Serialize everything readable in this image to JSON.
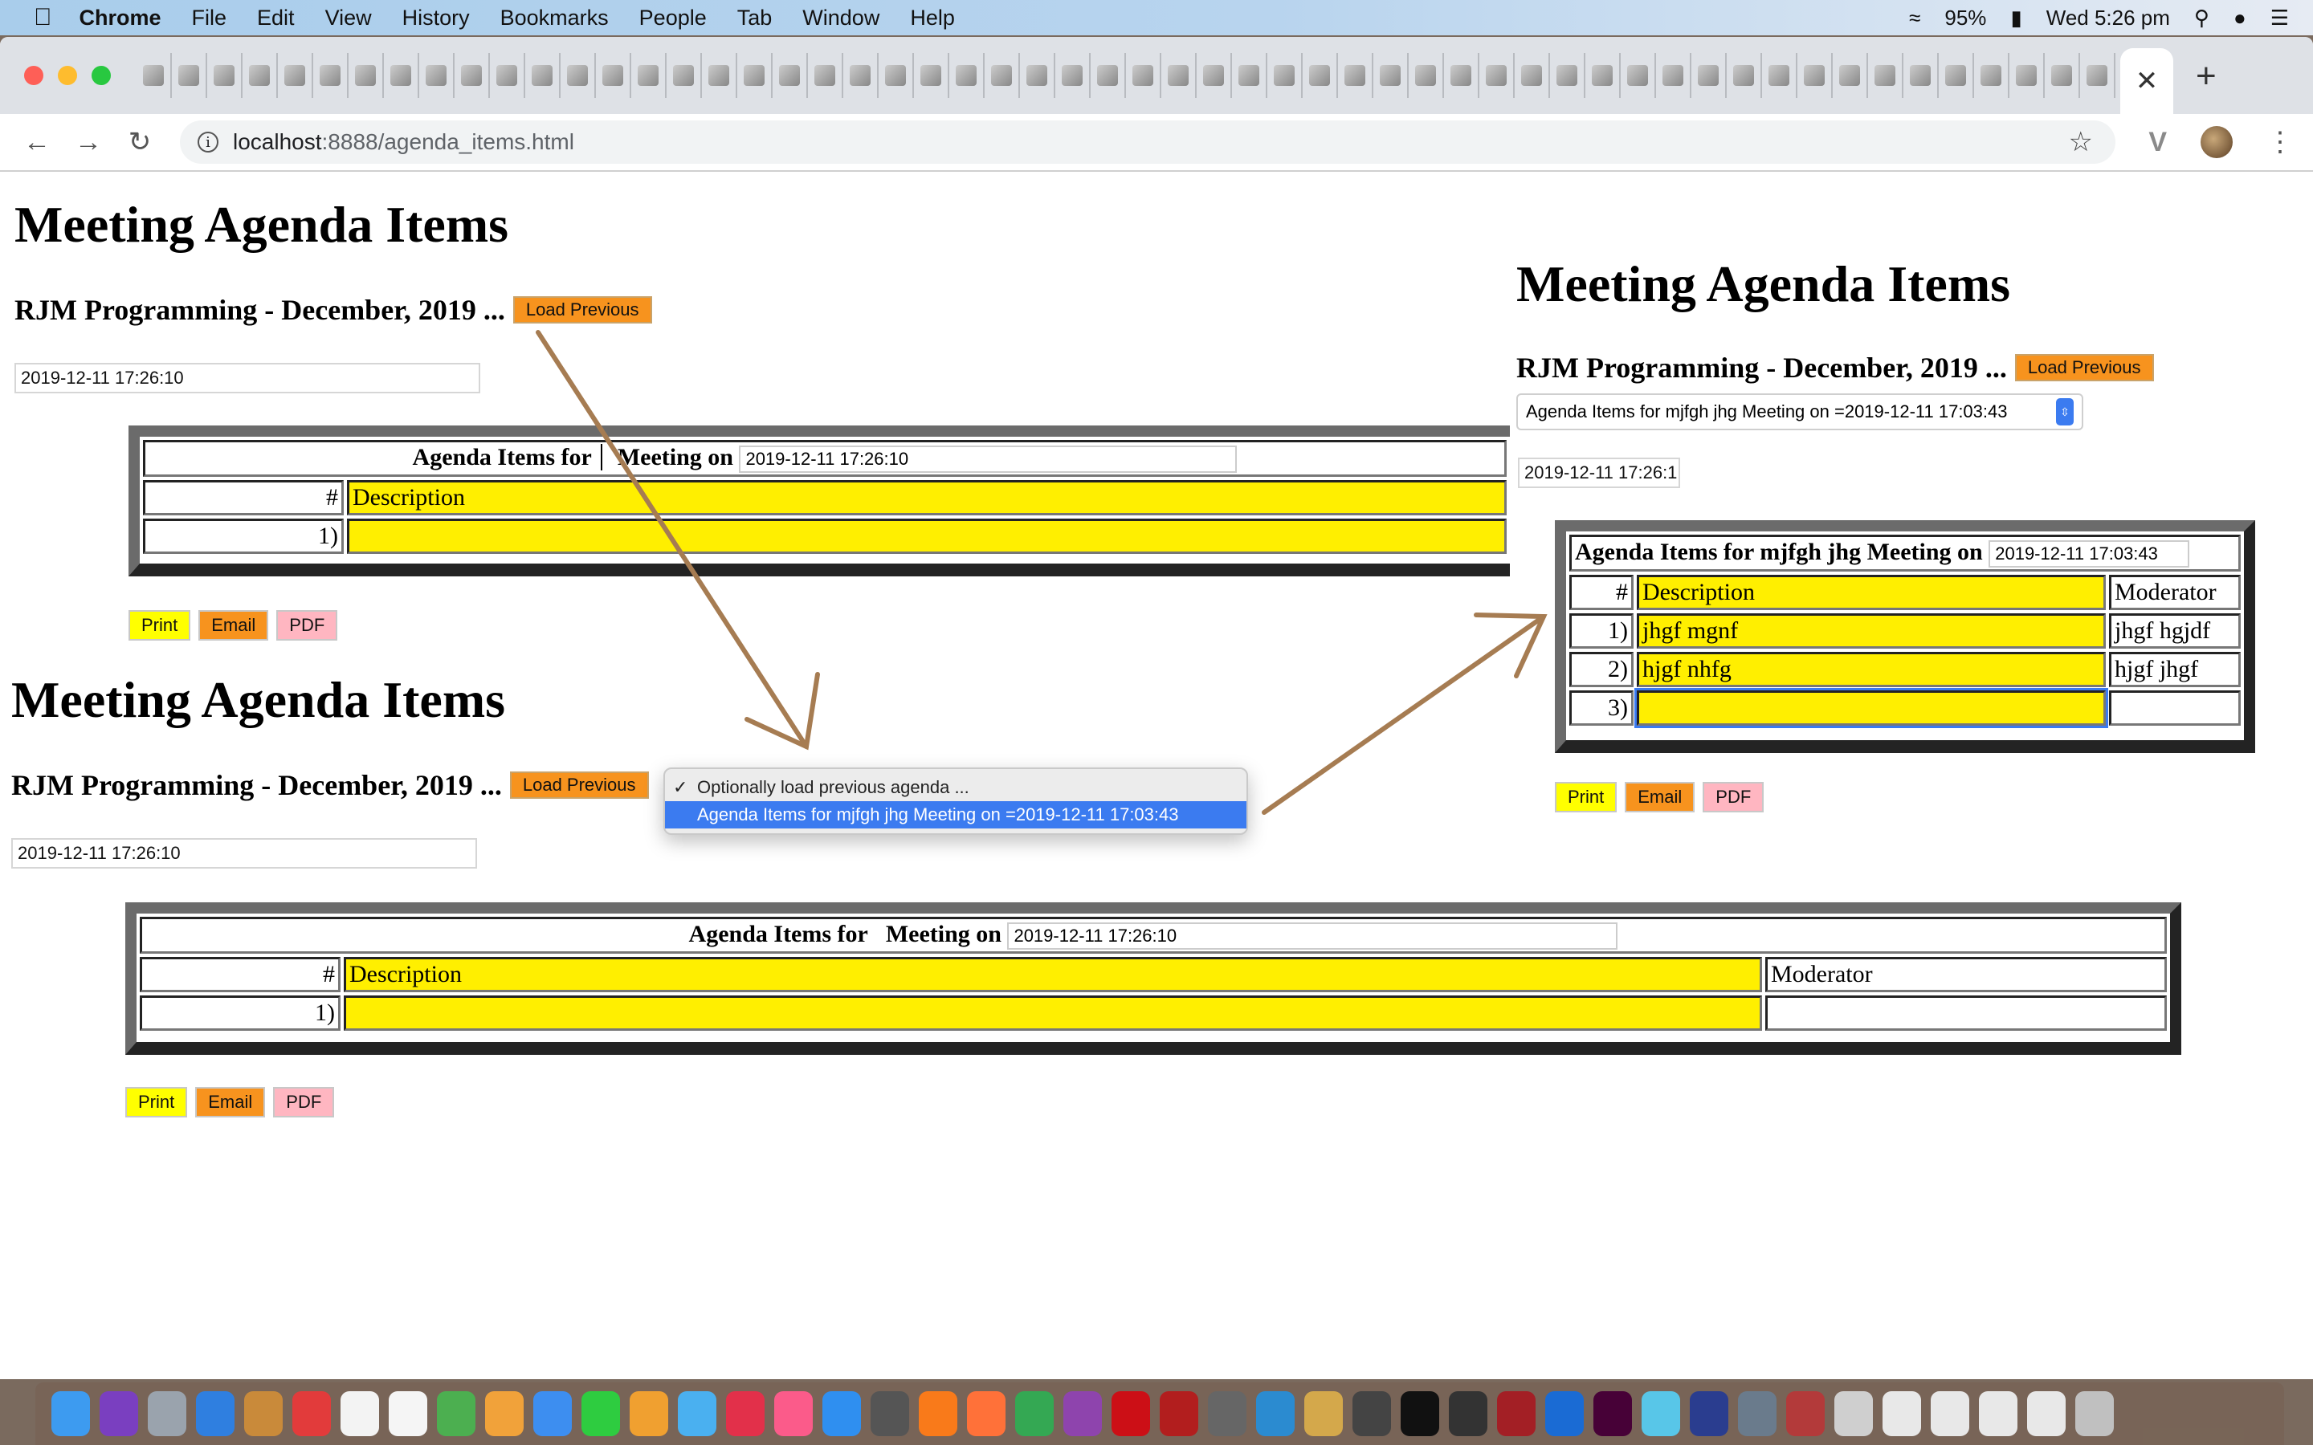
{
  "menubar": {
    "app_name": "Chrome",
    "items": [
      "File",
      "Edit",
      "View",
      "History",
      "Bookmarks",
      "People",
      "Tab",
      "Window",
      "Help"
    ],
    "battery": "95%",
    "clock": "Wed 5:26 pm"
  },
  "browser": {
    "favicon_tab_count": 56,
    "close_tab_label": "✕",
    "new_tab_label": "+",
    "url_host": "localhost",
    "url_path": ":8888/agenda_items.html"
  },
  "panels": {
    "top_left": {
      "title": "Meeting Agenda Items",
      "subtitle": "RJM Programming - December, 2019 ...",
      "load_button": "Load Previous",
      "date_value": "2019-12-11 17:26:10",
      "table_heading_prefix": "Agenda Items for",
      "table_heading_suffix": "Meeting on",
      "table_date": "2019-12-11 17:26:10",
      "col_num": "#",
      "col_desc": "Description",
      "rows": [
        {
          "num": "1)",
          "desc": ""
        }
      ],
      "actions": [
        "Print",
        "Email",
        "PDF"
      ]
    },
    "bottom_left": {
      "title": "Meeting Agenda Items",
      "subtitle": "RJM Programming - December, 2019 ...",
      "load_button": "Load Previous",
      "date_value": "2019-12-11 17:26:10",
      "table_heading_prefix": "Agenda Items for",
      "table_heading_suffix": "Meeting on",
      "table_date": "2019-12-11 17:26:10",
      "col_num": "#",
      "col_desc": "Description",
      "col_mod": "Moderator",
      "rows": [
        {
          "num": "1)",
          "desc": "",
          "mod": ""
        }
      ],
      "actions": [
        "Print",
        "Email",
        "PDF"
      ]
    },
    "right": {
      "title": "Meeting Agenda Items",
      "subtitle": "RJM Programming - December, 2019 ...",
      "load_button": "Load Previous",
      "select_value": "Agenda Items for mjfgh jhg Meeting on =2019-12-11 17:03:43",
      "date_value": "2019-12-11 17:26:1",
      "table_heading": "Agenda Items for mjfgh jhg Meeting on",
      "table_date": "2019-12-11 17:03:43",
      "col_num": "#",
      "col_desc": "Description",
      "col_mod": "Moderator",
      "rows": [
        {
          "num": "1)",
          "desc": "jhgf mgnf",
          "mod": "jhgf hgjdf"
        },
        {
          "num": "2)",
          "desc": "hjgf nhfg",
          "mod": "hjgf jhgf"
        },
        {
          "num": "3)",
          "desc": "",
          "mod": ""
        }
      ],
      "actions": [
        "Print",
        "Email",
        "PDF"
      ]
    }
  },
  "dropdown": {
    "options": [
      {
        "label": "Optionally load previous agenda ...",
        "checked": true,
        "highlighted": false
      },
      {
        "label": "Agenda Items for mjfgh jhg Meeting on =2019-12-11 17:03:43",
        "checked": false,
        "highlighted": true
      }
    ]
  },
  "colors": {
    "load_button": "#f7931e",
    "description_cell": "#ffef00",
    "print_button": "#ffff00",
    "email_button": "#f7931e",
    "pdf_button": "#ffb6c1",
    "selection_blue": "#3b7bf0",
    "arrow": "#a67c52"
  }
}
